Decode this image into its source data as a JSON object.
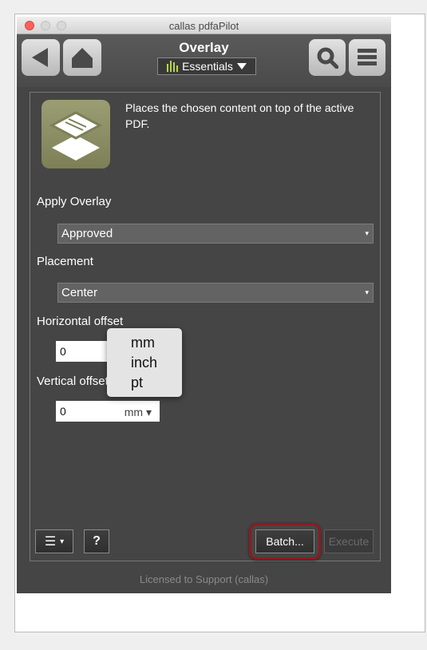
{
  "window": {
    "title": "callas pdfaPilot"
  },
  "toolbar": {
    "back_icon": "back-icon",
    "home_icon": "home-icon",
    "search_icon": "search-icon",
    "menu_icon": "menu-icon",
    "panel_title": "Overlay",
    "profile_selector": "Essentials"
  },
  "description": "Places the chosen content on top of the active PDF.",
  "form": {
    "apply_overlay": {
      "label": "Apply Overlay",
      "value": "Approved"
    },
    "placement": {
      "label": "Placement",
      "value": "Center"
    },
    "horizontal_offset": {
      "label": "Horizontal offset",
      "value": "0",
      "unit": "mm"
    },
    "vertical_offset": {
      "label": "Vertical offset",
      "value": "0",
      "unit": "mm"
    }
  },
  "unit_menu": {
    "options": [
      "mm",
      "inch",
      "pt"
    ]
  },
  "bottom_bar": {
    "options_symbol": "☰",
    "help_label": "?",
    "batch_label": "Batch...",
    "execute_label": "Execute"
  },
  "footer": "Licensed to Support (callas)",
  "colors": {
    "panel_bg": "#454545",
    "highlight": "#8e1a20",
    "close": "#fc605c"
  }
}
